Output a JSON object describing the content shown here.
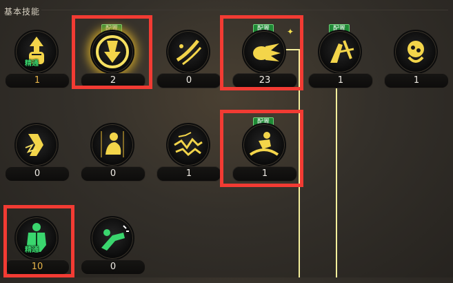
{
  "section": {
    "title": "基本技能"
  },
  "badge_label": "配置",
  "mastery_label": "精通",
  "skills": [
    {
      "name": "fist-icon",
      "level": "1",
      "badge": false,
      "mastery": true
    },
    {
      "name": "impact-icon",
      "level": "2",
      "badge": true,
      "mastery": false
    },
    {
      "name": "slash-icon",
      "level": "0",
      "badge": false,
      "mastery": false
    },
    {
      "name": "fireball-icon",
      "level": "23",
      "badge": true,
      "mastery": false
    },
    {
      "name": "kick-icon",
      "level": "1",
      "badge": true,
      "mastery": false
    },
    {
      "name": "grab-icon",
      "level": "1",
      "badge": false,
      "mastery": false
    },
    {
      "name": "lightning-leg-icon",
      "level": "0",
      "badge": false,
      "mastery": false
    },
    {
      "name": "crouch-icon",
      "level": "0",
      "badge": false,
      "mastery": false
    },
    {
      "name": "crack-icon",
      "level": "1",
      "badge": false,
      "mastery": false
    },
    {
      "name": "dash-icon",
      "level": "1",
      "badge": true,
      "mastery": false
    },
    {
      "name": "muscle-body-icon",
      "level": "10",
      "badge": false,
      "mastery": true
    },
    {
      "name": "punch-icon",
      "level": "0",
      "badge": false,
      "mastery": false
    }
  ],
  "colors": {
    "highlight": "#f23b33",
    "badge": "#1f8a36",
    "gold": "#e9b64a",
    "connector": "#f5ef9c"
  }
}
